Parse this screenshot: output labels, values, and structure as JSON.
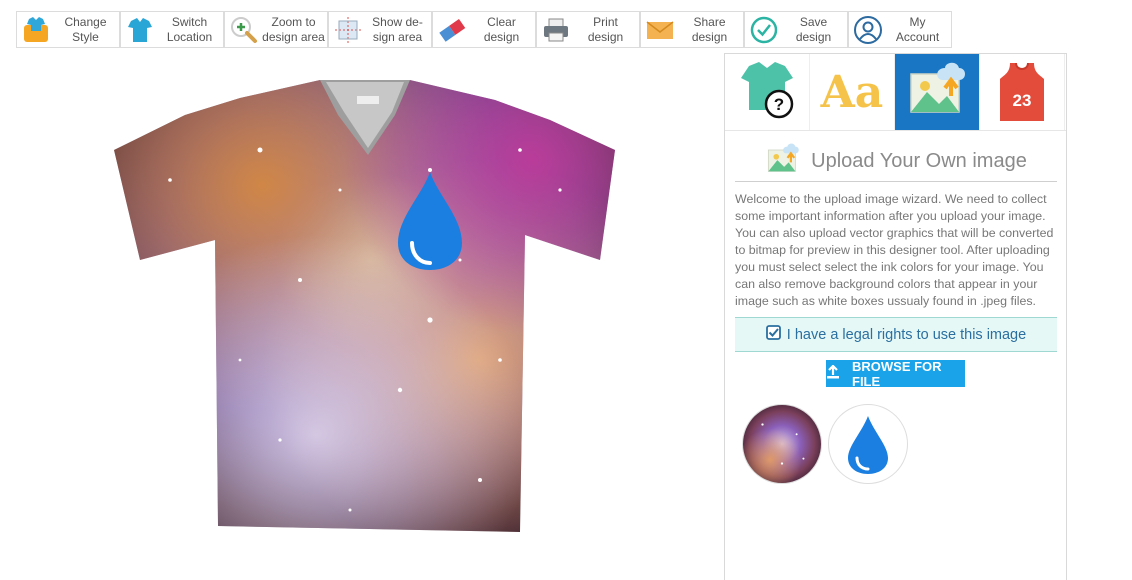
{
  "toolbar": {
    "items": [
      {
        "label": "Change\nStyle",
        "icon": "shirt-basket-icon"
      },
      {
        "label": "Switch\nLocation",
        "icon": "shirt-switch-icon"
      },
      {
        "label": "Zoom to\ndesign area",
        "icon": "zoom-in-icon"
      },
      {
        "label": "Show de-\nsign area",
        "icon": "design-area-icon"
      },
      {
        "label": "Clear\ndesign",
        "icon": "eraser-icon"
      },
      {
        "label": "Print\ndesign",
        "icon": "printer-icon"
      },
      {
        "label": "Share\ndesign",
        "icon": "envelope-icon"
      },
      {
        "label": "Save\ndesign",
        "icon": "checkmark-icon"
      },
      {
        "label": "My\nAccount",
        "icon": "user-icon"
      }
    ]
  },
  "tabs": [
    {
      "name": "product-help",
      "icon": "shirt-question-icon"
    },
    {
      "name": "text",
      "icon": "text-aa-icon",
      "text": "Aa"
    },
    {
      "name": "upload-image",
      "icon": "image-upload-icon",
      "active": true
    },
    {
      "name": "jersey",
      "icon": "jersey-icon",
      "number": "23"
    }
  ],
  "upload": {
    "title": "Upload Your Own image",
    "description": "Welcome to the upload image wizard. We need to collect some important information after you upload your image. You can also upload vector graphics that will be converted to bitmap for preview in this designer tool. After uploading you must select select the ink colors for your image. You can also remove background colors that appear in your image such as white boxes ussualy found in .jpeg files.",
    "legal_label": "I have a legal rights to use this image",
    "legal_checked": true,
    "browse_label": "BROWSE FOR FILE"
  },
  "thumbnails": [
    {
      "icon": "galaxy-thumbnail"
    },
    {
      "icon": "water-drop-thumbnail"
    }
  ],
  "colors": {
    "accent": "#1976c5",
    "browse": "#1aa3e8",
    "drop": "#1a7fe0",
    "legal_bg": "#e6f8f6"
  }
}
